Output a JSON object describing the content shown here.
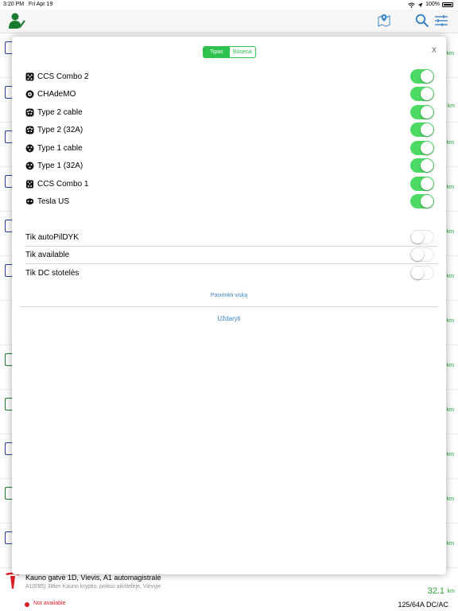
{
  "status_bar": {
    "time": "3:20 PM",
    "date": "Fri Apr 19",
    "battery": "100%"
  },
  "nav": {
    "icons": [
      "user-check-icon",
      "map-pin-icon",
      "search-icon",
      "filter-icon"
    ]
  },
  "background": {
    "km_unit": "km"
  },
  "bottom_row": {
    "address": "Kauno gatvė 1D, Vievis, A1 automagistralė",
    "sub": "A1(E85) 38km Kauno kryptis, poilsio aikštelėje, Vievyje",
    "distance": "32.1",
    "unit": "km",
    "status": "Not available",
    "power": "125/64A DC/AC",
    "colors": {
      "available": "#27a737",
      "unavailable": "#e01b24"
    }
  },
  "modal": {
    "tabs": [
      {
        "label": "Tipas",
        "active": true
      },
      {
        "label": "Būsena",
        "active": false
      }
    ],
    "close": "X",
    "connectors": [
      {
        "label": "CCS Combo 2",
        "icon": "ccs-combo-2-icon",
        "on": true
      },
      {
        "label": "CHAdeMO",
        "icon": "chademo-icon",
        "on": true
      },
      {
        "label": "Type 2 cable",
        "icon": "type2-cable-icon",
        "on": true
      },
      {
        "label": "Type 2 (32A)",
        "icon": "type2-32a-icon",
        "on": true
      },
      {
        "label": "Type 1 cable",
        "icon": "type1-cable-icon",
        "on": true
      },
      {
        "label": "Type 1 (32A)",
        "icon": "type1-32a-icon",
        "on": true
      },
      {
        "label": "CCS Combo 1",
        "icon": "ccs-combo-1-icon",
        "on": true
      },
      {
        "label": "Tesla US",
        "icon": "tesla-us-icon",
        "on": true
      }
    ],
    "options": [
      {
        "label": "Tik autoPilDYK",
        "on": false
      },
      {
        "label": "Tik available",
        "on": false
      },
      {
        "label": "Tik DC stotelės",
        "on": false
      }
    ],
    "select_all": "Pasirinkti viską",
    "close_button": "Uždaryti",
    "accent_color": "#2dc24d",
    "toggle_on_color": "#4cd964",
    "link_color": "#3e86c8"
  }
}
